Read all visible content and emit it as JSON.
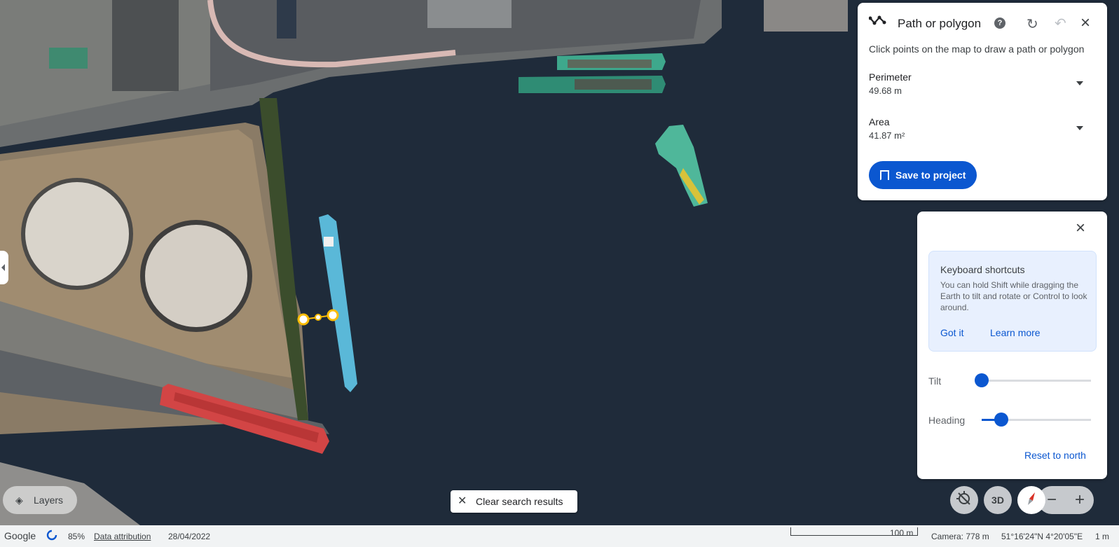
{
  "path_panel": {
    "title": "Path or polygon",
    "help_icon": "help-icon",
    "instructions": "Click points on the map to draw a path or polygon",
    "perimeter_label": "Perimeter",
    "perimeter_value": "49.68 m",
    "area_label": "Area",
    "area_value": "41.87 m²",
    "save_label": "Save to project"
  },
  "nav_panel": {
    "shortcuts_title": "Keyboard shortcuts",
    "shortcuts_text": "You can hold Shift while dragging the Earth to tilt and rotate or Control to look around.",
    "got_it": "Got it",
    "learn_more": "Learn more",
    "tilt_label": "Tilt",
    "tilt_fraction": 0.0,
    "heading_label": "Heading",
    "heading_fraction": 0.18,
    "reset_north": "Reset to north"
  },
  "controls": {
    "layers_label": "Layers",
    "clear_search": "Clear search results",
    "three_d": "3D",
    "zoom_out": "−",
    "zoom_in": "+"
  },
  "status": {
    "brand": "Google",
    "loading_percent": "85%",
    "attribution": "Data attribution",
    "date": "28/04/2022",
    "scale": "100 m",
    "camera": "Camera: 778 m",
    "coordinates": "51°16'24\"N 4°20'05\"E",
    "elevation": "1 m"
  },
  "colors": {
    "accent": "#0b57d0",
    "water": "#1f2b3a",
    "measure_line": "#fbbc04"
  }
}
